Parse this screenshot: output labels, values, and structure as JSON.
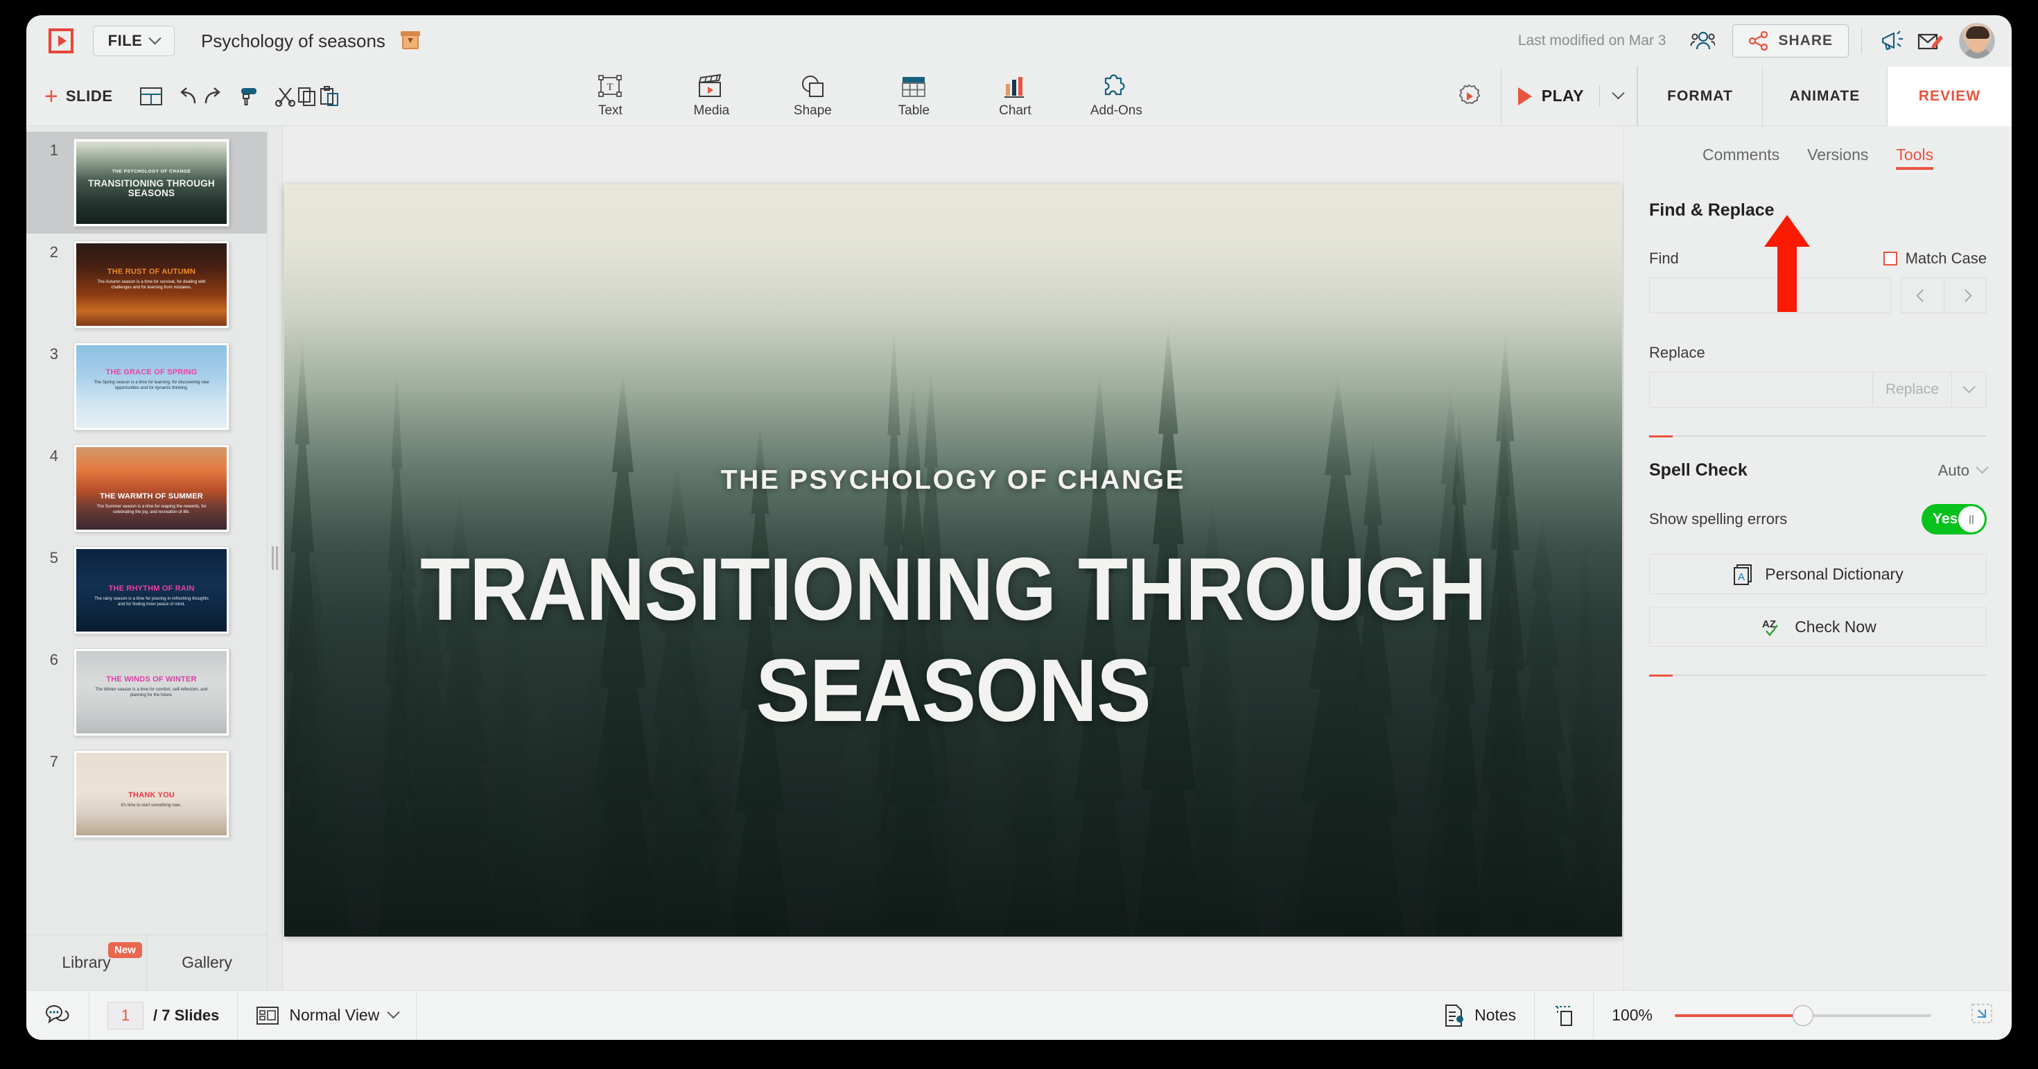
{
  "app": {
    "brand_red": "#e8543f",
    "accent_teal": "#16607f",
    "file_menu_label": "FILE",
    "document_title": "Psychology of seasons",
    "last_modified": "Last modified on Mar 3",
    "share_label": "SHARE"
  },
  "ribbon": {
    "slide_label": "SLIDE",
    "insert_items": [
      {
        "label": "Text",
        "icon": "text-box-icon"
      },
      {
        "label": "Media",
        "icon": "media-clapperboard-icon"
      },
      {
        "label": "Shape",
        "icon": "shape-icon"
      },
      {
        "label": "Table",
        "icon": "table-icon"
      },
      {
        "label": "Chart",
        "icon": "chart-icon"
      },
      {
        "label": "Add-Ons",
        "icon": "puzzle-piece-icon"
      }
    ],
    "play_label": "PLAY",
    "tabs": [
      {
        "label": "FORMAT",
        "active": false
      },
      {
        "label": "ANIMATE",
        "active": false
      },
      {
        "label": "REVIEW",
        "active": true
      }
    ]
  },
  "sidebar": {
    "slides": [
      {
        "num": "1",
        "kicker": "THE PSYCHOLOGY OF CHANGE",
        "title": "TRANSITIONING THROUGH SEASONS",
        "subtitle": "",
        "selected": true,
        "theme": "forest"
      },
      {
        "num": "2",
        "kicker": "",
        "title": "THE RUST OF AUTUMN",
        "subtitle": "The Autumn season is a time for survival, for dealing with challenges and for learning from mistakes.",
        "selected": false,
        "theme": "autumn"
      },
      {
        "num": "3",
        "kicker": "",
        "title": "THE GRACE OF SPRING",
        "subtitle": "The Spring season is a time for learning, for discovering new opportunities and for dynamic thinking.",
        "selected": false,
        "theme": "spring"
      },
      {
        "num": "4",
        "kicker": "",
        "title": "THE WARMTH OF SUMMER",
        "subtitle": "The Summer season is a time for reaping the rewards, for celebrating the joy, and recreation of life.",
        "selected": false,
        "theme": "summer"
      },
      {
        "num": "5",
        "kicker": "",
        "title": "THE RHYTHM OF RAIN",
        "subtitle": "The rainy season is a time for pouring in refreshing thoughts and for finding inner peace of mind.",
        "selected": false,
        "theme": "rain"
      },
      {
        "num": "6",
        "kicker": "",
        "title": "THE WINDS OF WINTER",
        "subtitle": "The Winter season is a time for comfort, self-reflection, and planning for the future.",
        "selected": false,
        "theme": "winter"
      },
      {
        "num": "7",
        "kicker": "",
        "title": "THANK YOU",
        "subtitle": "It's time to start something new..",
        "selected": false,
        "theme": "thanks"
      }
    ],
    "bottom_tabs": [
      {
        "label": "Library",
        "badge": "New"
      },
      {
        "label": "Gallery",
        "badge": ""
      }
    ]
  },
  "canvas": {
    "kicker": "THE PSYCHOLOGY OF CHANGE",
    "title": "TRANSITIONING THROUGH SEASONS"
  },
  "right_panel": {
    "subtabs": [
      {
        "label": "Comments",
        "active": false
      },
      {
        "label": "Versions",
        "active": false
      },
      {
        "label": "Tools",
        "active": true
      }
    ],
    "find_replace": {
      "heading": "Find & Replace",
      "match_case_label": "Match Case",
      "match_case_checked": false,
      "find_label": "Find",
      "find_value": "",
      "replace_label": "Replace",
      "replace_value": "",
      "replace_button_label": "Replace"
    },
    "spell_check": {
      "heading": "Spell Check",
      "mode": "Auto",
      "show_errors_label": "Show spelling errors",
      "toggle_value": "Yes",
      "personal_dictionary_label": "Personal Dictionary",
      "check_now_label": "Check Now"
    }
  },
  "status_bar": {
    "current_slide": "1",
    "total_slides": "/ 7 Slides",
    "view_mode": "Normal View",
    "notes_label": "Notes",
    "zoom_level": "100%"
  }
}
